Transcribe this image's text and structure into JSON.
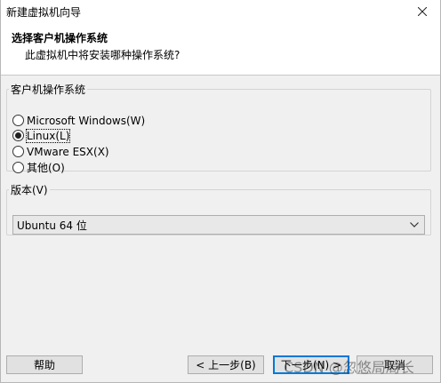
{
  "window": {
    "title": "新建虚拟机向导",
    "close_icon": "close-icon"
  },
  "header": {
    "title": "选择客户机操作系统",
    "subtitle": "此虚拟机中将安装哪种操作系统?"
  },
  "os_group": {
    "legend": "客户机操作系统",
    "options": [
      {
        "label": "Microsoft Windows(W)",
        "checked": false
      },
      {
        "label": "Linux(L)",
        "checked": true
      },
      {
        "label": "VMware ESX(X)",
        "checked": false
      },
      {
        "label": "其他(O)",
        "checked": false
      }
    ]
  },
  "version_group": {
    "legend": "版本(V)",
    "selected": "Ubuntu 64 位"
  },
  "buttons": {
    "help": "帮助",
    "back": "< 上一步(B)",
    "next": "下一步(N) >",
    "cancel": "取消"
  },
  "watermark": "CSDN @忽悠局局长",
  "colors": {
    "focus_border": "#0078d7",
    "header_bg": "#ffffff",
    "body_bg": "#f0f0f0"
  }
}
